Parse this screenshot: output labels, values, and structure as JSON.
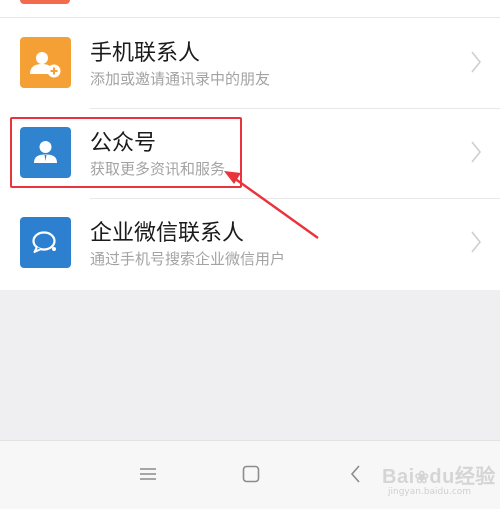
{
  "rows": [
    {
      "title": "手机联系人",
      "subtitle": "添加或邀请通讯录中的朋友",
      "icon": "phone-contact-add-icon",
      "icon_color": "#f5a035"
    },
    {
      "title": "公众号",
      "subtitle": "获取更多资讯和服务",
      "icon": "official-account-person-icon",
      "icon_color": "#2f83cf"
    },
    {
      "title": "企业微信联系人",
      "subtitle": "通过手机号搜索企业微信用户",
      "icon": "work-wechat-chat-icon",
      "icon_color": "#2d7fd0"
    }
  ],
  "annotation": {
    "color": "#e8343a"
  },
  "navbar": {
    "menu": "☰",
    "home": "▢",
    "back": "‹"
  },
  "watermark": {
    "brand": "Bai",
    "paw": "du",
    "suffix": "经验",
    "url": "jingyan.baidu.com"
  }
}
